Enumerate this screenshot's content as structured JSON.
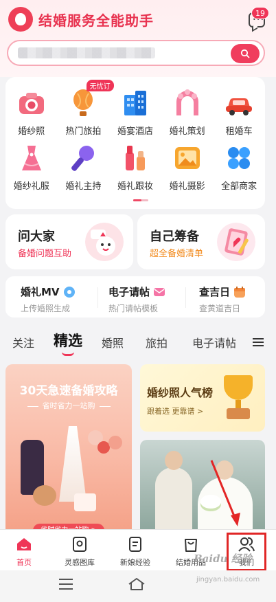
{
  "header": {
    "app_title": "结婚服务全能助手",
    "message_badge": "19",
    "search_placeholder": ""
  },
  "categories": [
    {
      "label": "婚纱照",
      "icon": "camera-icon",
      "tag": ""
    },
    {
      "label": "热门旅拍",
      "icon": "hot-air-balloon-icon",
      "tag": "无忧订"
    },
    {
      "label": "婚宴酒店",
      "icon": "hotel-icon",
      "tag": ""
    },
    {
      "label": "婚礼策划",
      "icon": "wedding-arch-icon",
      "tag": ""
    },
    {
      "label": "租婚车",
      "icon": "car-icon",
      "tag": ""
    },
    {
      "label": "婚纱礼服",
      "icon": "dress-icon",
      "tag": ""
    },
    {
      "label": "婚礼主持",
      "icon": "microphone-icon",
      "tag": ""
    },
    {
      "label": "婚礼跟妆",
      "icon": "makeup-icon",
      "tag": ""
    },
    {
      "label": "婚礼摄影",
      "icon": "photo-icon",
      "tag": ""
    },
    {
      "label": "全部商家",
      "icon": "grid-icon",
      "tag": ""
    }
  ],
  "promos": {
    "left": {
      "title": "问大家",
      "subtitle": "备婚问题互助"
    },
    "right": {
      "title": "自己筹备",
      "subtitle": "超全备婚清单"
    }
  },
  "tools": [
    {
      "title": "婚礼MV",
      "subtitle": "上传婚照生成"
    },
    {
      "title": "电子请帖",
      "subtitle": "热门请帖模板"
    },
    {
      "title": "查吉日",
      "subtitle": "查黄道吉日"
    }
  ],
  "tabs": [
    "关注",
    "精选",
    "婚照",
    "旅拍",
    "电子请帖"
  ],
  "active_tab": "精选",
  "feed": {
    "left_card": {
      "title": "30天急速备婚攻略",
      "subtitle": "省时省力一站购",
      "pill": "省时省力一站购 >"
    },
    "right_card": {
      "title": "婚纱照人气榜",
      "subtitle": "跟着选 更靠谱 >"
    }
  },
  "tabbar": [
    {
      "label": "首页",
      "icon": "home-icon",
      "active": true
    },
    {
      "label": "灵感图库",
      "icon": "gallery-icon",
      "active": false
    },
    {
      "label": "新娘经验",
      "icon": "notes-icon",
      "active": false
    },
    {
      "label": "结婚用品",
      "icon": "shopping-bag-icon",
      "active": false
    },
    {
      "label": "我们",
      "icon": "users-icon",
      "active": false
    }
  ],
  "watermark": {
    "text": "Baidu 经验",
    "sub": "jingyan.baidu.com"
  },
  "colors": {
    "brand": "#ef3557",
    "accent_orange": "#f28a1c"
  }
}
